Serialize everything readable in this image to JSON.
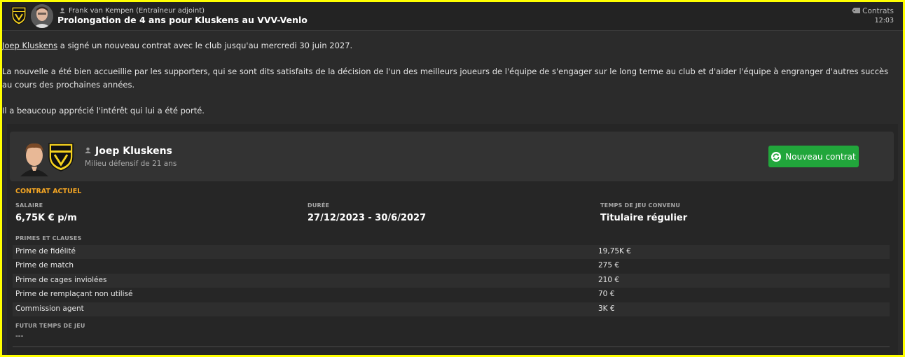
{
  "header": {
    "sender": "Frank van Kempen (Entraîneur adjoint)",
    "subject": "Prolongation de 4 ans pour Kluskens au VVV-Venlo",
    "category": "Contrats",
    "time": "12:03"
  },
  "body": {
    "p1_name": "Joep Kluskens",
    "p1_rest": " a signé un nouveau contrat avec le club jusqu'au mercredi 30 juin 2027.",
    "p2": "La nouvelle a été bien accueillie par les supporters, qui se sont dits satisfaits de la décision de l'un des meilleurs joueurs de l'équipe de s'engager sur le long terme au club et d'aider l'équipe à engranger d'autres succès au cours des prochaines années.",
    "p3": "Il a beaucoup apprécié l'intérêt qui lui a été porté."
  },
  "player": {
    "name": "Joep Kluskens",
    "role": "Milieu défensif de 21 ans",
    "new_contract_label": "Nouveau contrat"
  },
  "contract": {
    "section_title": "CONTRAT ACTUEL",
    "salary_label": "SALAIRE",
    "salary_value": "6,75K € p/m",
    "duration_label": "DURÉE",
    "duration_value": "27/12/2023 - 30/6/2027",
    "playtime_label": "TEMPS DE JEU CONVENU",
    "playtime_value": "Titulaire régulier",
    "bonuses_label": "PRIMES ET CLAUSES",
    "bonuses": [
      {
        "name": "Prime de fidélité",
        "value": "19,75K €"
      },
      {
        "name": "Prime de match",
        "value": "275 €"
      },
      {
        "name": "Prime de cages inviolées",
        "value": "210 €"
      },
      {
        "name": "Prime de remplaçant non utilisé",
        "value": "70 €"
      },
      {
        "name": "Commission agent",
        "value": "3K €"
      }
    ],
    "future_label": "FUTUR TEMPS DE JEU",
    "future_value": "---"
  },
  "colors": {
    "accent": "#f5a623",
    "button": "#21a63b",
    "club_yellow": "#f6d21e",
    "frame": "#ffff00"
  },
  "icons": [
    "club-logo-icon",
    "person-icon",
    "tag-icon",
    "refresh-icon"
  ]
}
